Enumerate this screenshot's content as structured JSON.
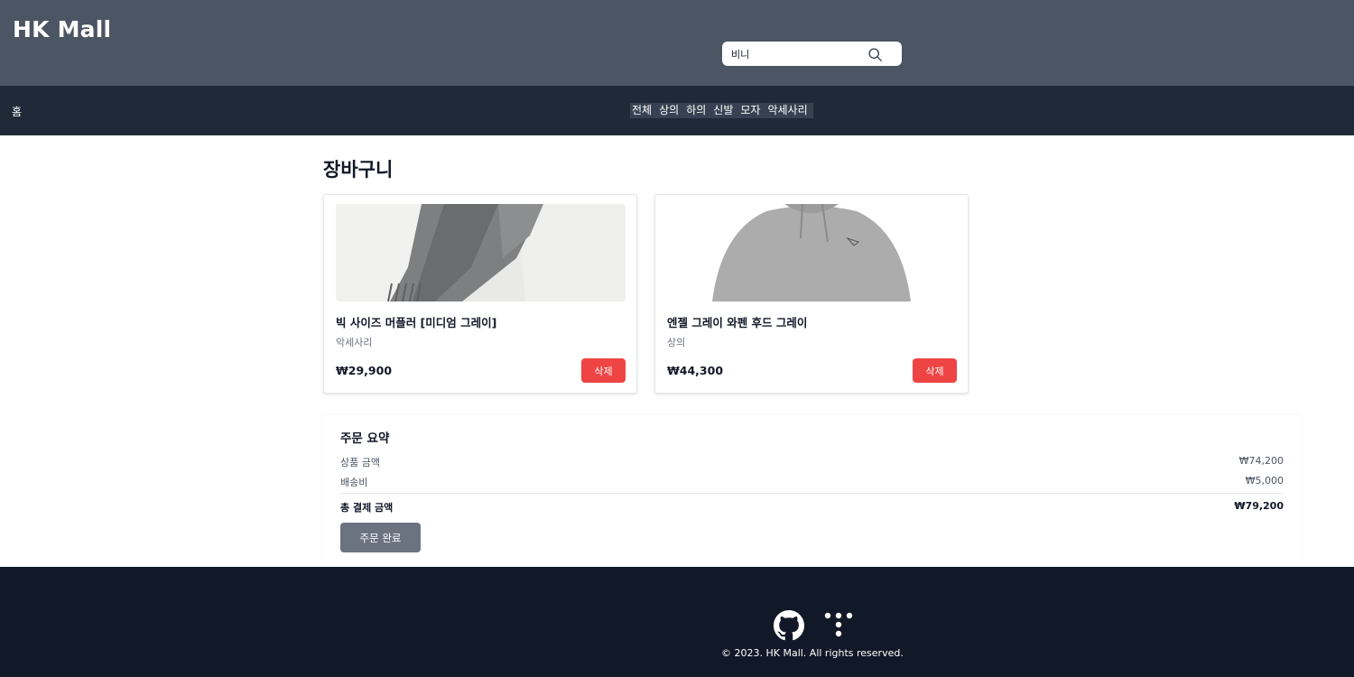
{
  "header": {
    "brand": "HK Mall",
    "search": {
      "value": "비니",
      "placeholder": ""
    }
  },
  "nav": {
    "home": "홈",
    "categories": [
      "전체",
      "상의",
      "하의",
      "신발",
      "모자",
      "악세사리"
    ]
  },
  "cart": {
    "title": "장바구니",
    "items": [
      {
        "name": "빅 사이즈 머플러 [미디엄 그레이]",
        "category": "악세사리",
        "price": "₩29,900",
        "delete_label": "삭제",
        "image_icon": "gray-muffler-photo"
      },
      {
        "name": "엔젤 그레이 와펜 후드 그레이",
        "category": "상의",
        "price": "₩44,300",
        "delete_label": "삭제",
        "image_icon": "gray-hoodie-photo"
      }
    ]
  },
  "summary": {
    "title": "주문 요약",
    "subtotal_label": "상품 금액",
    "subtotal": "₩74,200",
    "shipping_label": "배송비",
    "shipping": "₩5,000",
    "total_label": "총 결제 금액",
    "total": "₩79,200",
    "order_button": "주문 완료"
  },
  "footer": {
    "copyright": "© 2023. HK Mall. All rights reserved.",
    "icons": [
      "github-icon",
      "tistory-icon"
    ]
  },
  "colors": {
    "header_bg": "#4b5563",
    "nav_bg": "#1f2937",
    "footer_bg": "#111827",
    "delete": "#ef4444",
    "order_button": "#6b7280"
  }
}
